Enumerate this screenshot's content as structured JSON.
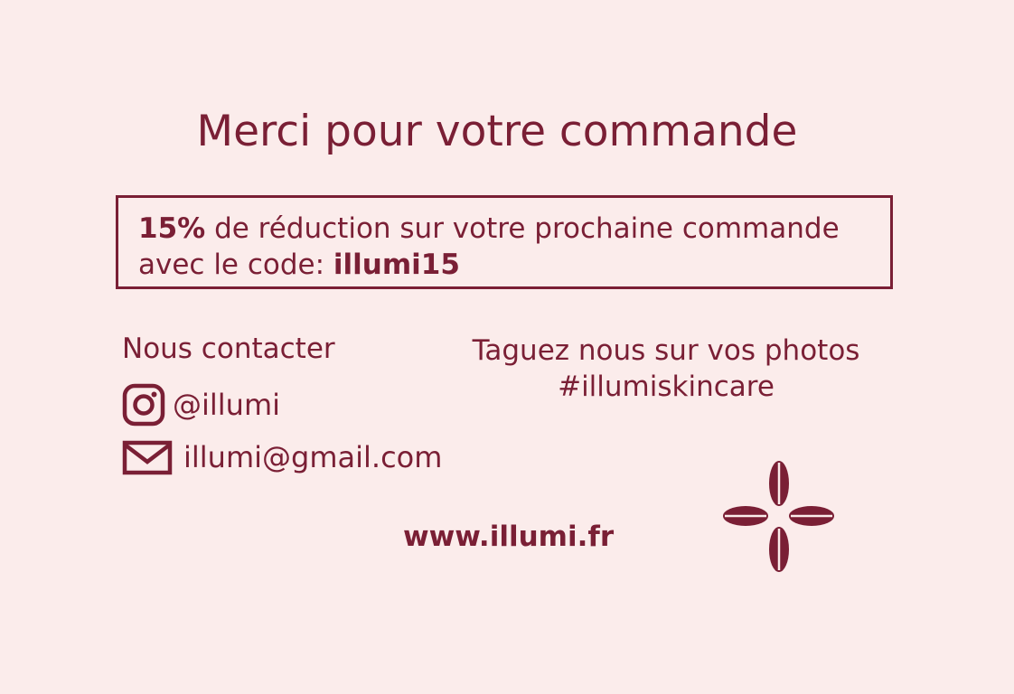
{
  "title": "Merci pour votre commande",
  "promo": {
    "percent": "15%",
    "line1_rest": "de réduction sur votre prochaine commande",
    "line2_prefix": "avec le code:",
    "code": "illumi15"
  },
  "contact": {
    "heading": "Nous contacter",
    "instagram": "@illumi",
    "instagram_icon": "instagram-icon",
    "email": "illumi@gmail.com",
    "email_icon": "envelope-icon"
  },
  "tag": {
    "line1": "Taguez nous sur vos photos",
    "hashtag": "#illumiskincare"
  },
  "website": "www.illumi.fr",
  "colors": {
    "background": "#fbeceb",
    "accent": "#7a1f35"
  }
}
